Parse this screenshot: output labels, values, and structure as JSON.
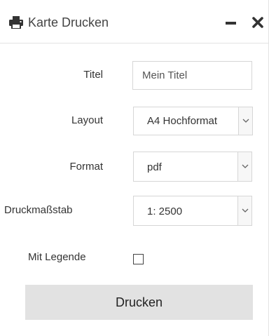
{
  "header": {
    "title": "Karte Drucken",
    "icon": "printer-icon",
    "minimize_icon": "minimize-icon",
    "close_icon": "close-icon"
  },
  "form": {
    "title_label": "Titel",
    "title_placeholder": "Mein Titel",
    "title_value": "",
    "layout_label": "Layout",
    "layout_value": "A4 Hochformat",
    "format_label": "Format",
    "format_value": "pdf",
    "scale_label": "Druckmaßstab",
    "scale_value": "1: 2500",
    "legend_label": "Mit Legende",
    "legend_checked": false,
    "print_label": "Drucken"
  },
  "colors": {
    "button_background": "#e2e2e2",
    "border": "#d6d6d6",
    "text": "#333333"
  }
}
